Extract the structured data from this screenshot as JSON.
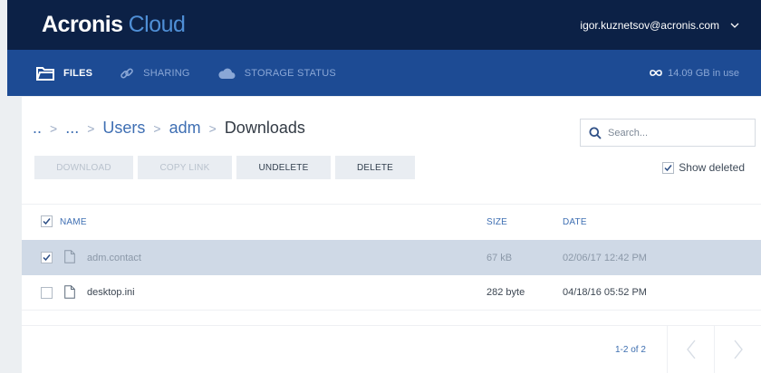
{
  "app": {
    "brand": "Acronis",
    "product": "Cloud"
  },
  "account": {
    "email": "igor.kuznetsov@acronis.com"
  },
  "nav": {
    "tabs": [
      {
        "label": "FILES",
        "icon": "folder-icon",
        "active": true
      },
      {
        "label": "SHARING",
        "icon": "link-icon",
        "active": false
      },
      {
        "label": "STORAGE STATUS",
        "icon": "cloud-icon",
        "active": false
      }
    ],
    "usage": "14.09 GB in use"
  },
  "breadcrumb": [
    {
      "label": "..",
      "type": "link"
    },
    {
      "label": "...",
      "type": "link"
    },
    {
      "label": "Users",
      "type": "link"
    },
    {
      "label": "adm",
      "type": "link"
    },
    {
      "label": "Downloads",
      "type": "current"
    }
  ],
  "search": {
    "placeholder": "Search..."
  },
  "toolbar": {
    "download": "DOWNLOAD",
    "copy_link": "COPY LINK",
    "undelete": "UNDELETE",
    "delete": "DELETE"
  },
  "show_deleted": {
    "label": "Show deleted",
    "checked": true
  },
  "table": {
    "columns": {
      "name": "NAME",
      "size": "SIZE",
      "date": "DATE"
    },
    "rows": [
      {
        "name": "adm.contact",
        "size": "67 kB",
        "date": "02/06/17 12:42 PM",
        "checked": true,
        "deleted": true
      },
      {
        "name": "desktop.ini",
        "size": "282 byte",
        "date": "04/18/16 05:52 PM",
        "checked": false,
        "deleted": false
      }
    ]
  },
  "pagination": {
    "range": "1-2 of 2"
  },
  "colors": {
    "topbar": "#0c2146",
    "navbar": "#1d4b94",
    "accent": "#3f6fb3",
    "selected_row": "#cfd9e6"
  }
}
